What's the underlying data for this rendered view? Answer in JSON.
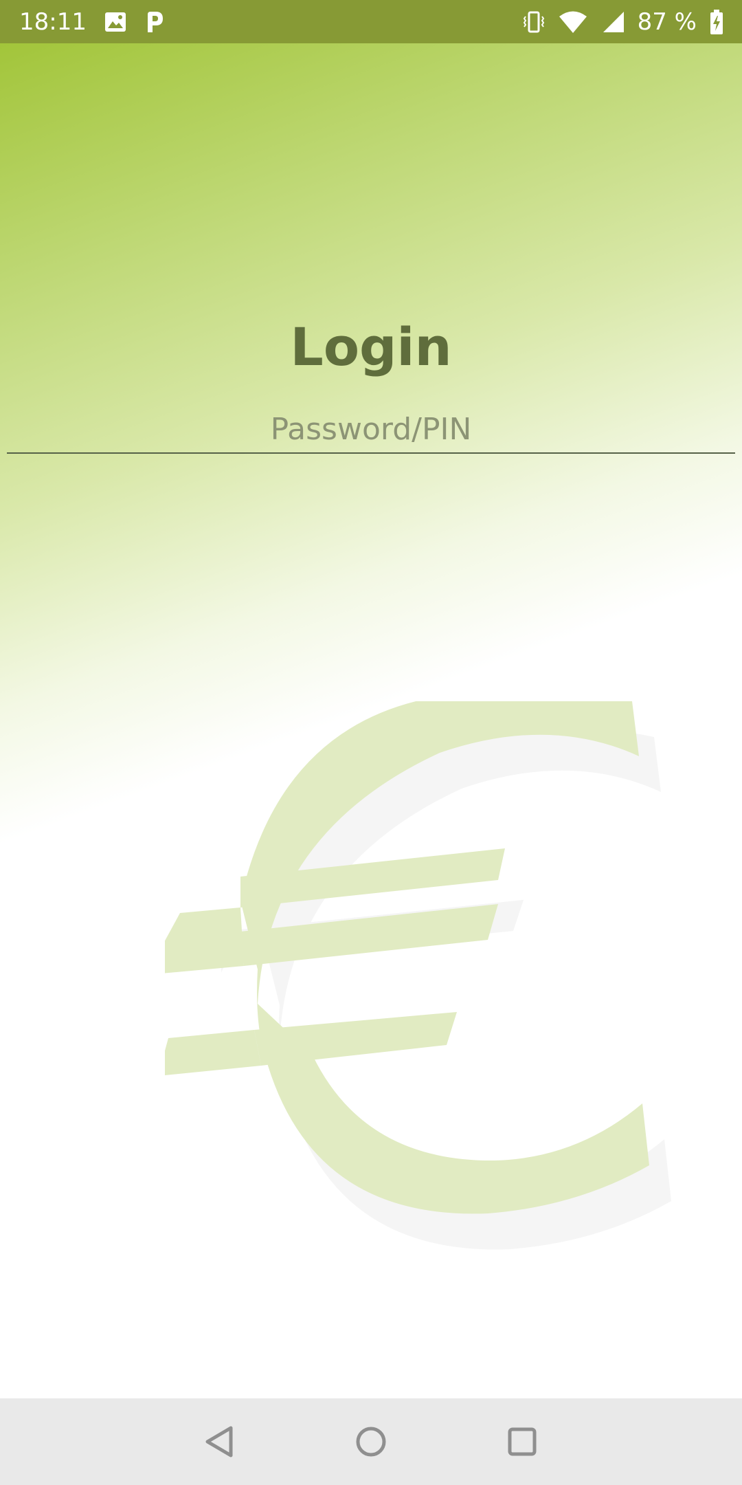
{
  "status_bar": {
    "time": "18:11",
    "battery_percent": "87 %",
    "icons": [
      "image-icon",
      "parking-app-icon",
      "vibrate-icon",
      "wifi-icon",
      "cellular-signal-icon",
      "battery-charging-icon"
    ]
  },
  "login": {
    "title": "Login",
    "password_placeholder": "Password/PIN",
    "password_value": ""
  },
  "background": {
    "watermark_icon": "euro-icon",
    "gradient_colors": [
      "#a2c53a",
      "#ffffff"
    ]
  },
  "nav_bar": {
    "icons": [
      "back-icon",
      "home-icon",
      "recents-icon"
    ]
  },
  "colors": {
    "status_bar": "#879a35",
    "title": "#5f6d3c",
    "nav_bar": "#e9e9e9"
  }
}
